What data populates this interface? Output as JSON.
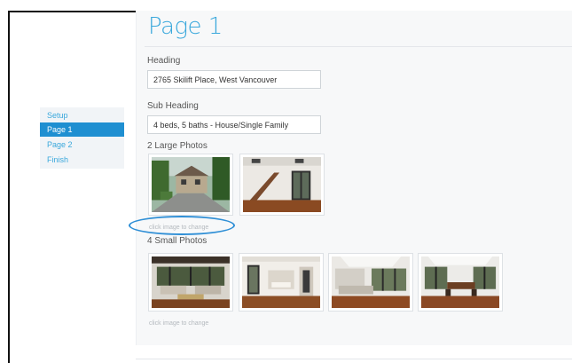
{
  "page": {
    "title": "Page 1"
  },
  "nav": {
    "items": [
      {
        "label": "Setup",
        "active": false
      },
      {
        "label": "Page 1",
        "active": true
      },
      {
        "label": "Page 2",
        "active": false
      },
      {
        "label": "Finish",
        "active": false
      }
    ]
  },
  "form": {
    "heading": {
      "label": "Heading",
      "value": "2765 Skilift Place, West Vancouver"
    },
    "subheading": {
      "label": "Sub Heading",
      "value": "4 beds, 5 baths - House/Single Family"
    }
  },
  "large_photos": {
    "label": "2 Large Photos",
    "hint": "click image to change",
    "items": [
      {
        "subject": "house-exterior"
      },
      {
        "subject": "entry-staircase"
      }
    ]
  },
  "small_photos": {
    "label": "4 Small Photos",
    "hint": "click image to change",
    "items": [
      {
        "subject": "living-room"
      },
      {
        "subject": "dining-hall"
      },
      {
        "subject": "kitchen"
      },
      {
        "subject": "dining-room"
      }
    ]
  },
  "colors": {
    "accent": "#3aa8dc",
    "nav_active": "#1f8fd1",
    "callout": "#2f8fd6"
  }
}
